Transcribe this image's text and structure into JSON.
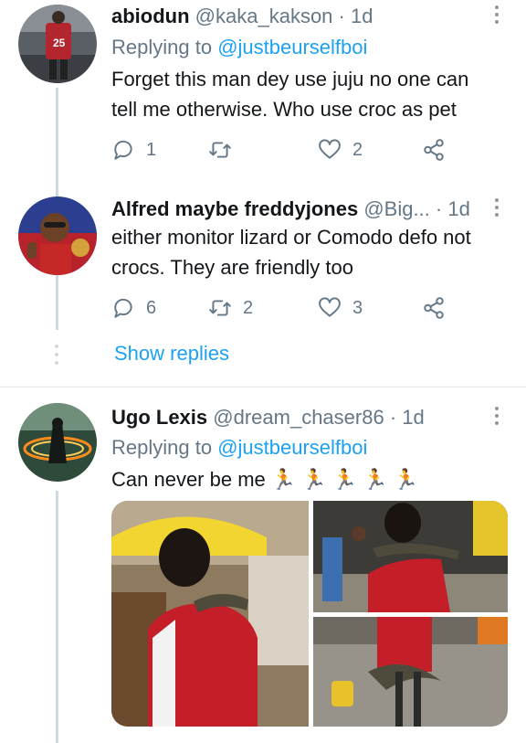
{
  "tweets": [
    {
      "name": "abiodun",
      "handle": "@kaka_kakson",
      "time": "· 1d",
      "replying_prefix": "Replying to ",
      "replying_handle": "@justbeurselfboi",
      "text": "Forget this man dey use juju no one can tell me otherwise. Who use croc as pet",
      "replies": "1",
      "retweets": "",
      "likes": "2"
    },
    {
      "name": "Alfred maybe freddyjones",
      "handle": "@Big...",
      "time": "· 1d",
      "text": "either monitor lizard or Comodo defo not crocs. They are friendly too",
      "replies": "6",
      "retweets": "2",
      "likes": "3",
      "show_replies": "Show replies"
    },
    {
      "name": "Ugo Lexis",
      "handle": "@dream_chaser86",
      "time": "· 1d",
      "replying_prefix": "Replying to ",
      "replying_handle": "@justbeurselfboi",
      "text": "Can never be me 🏃 🏃 🏃 🏃 🏃",
      "media_count": 3
    }
  ],
  "colors": {
    "link": "#1da1f2",
    "secondary": "#657786",
    "thread_line": "#cfd9de",
    "divider": "#e1e8ed"
  }
}
